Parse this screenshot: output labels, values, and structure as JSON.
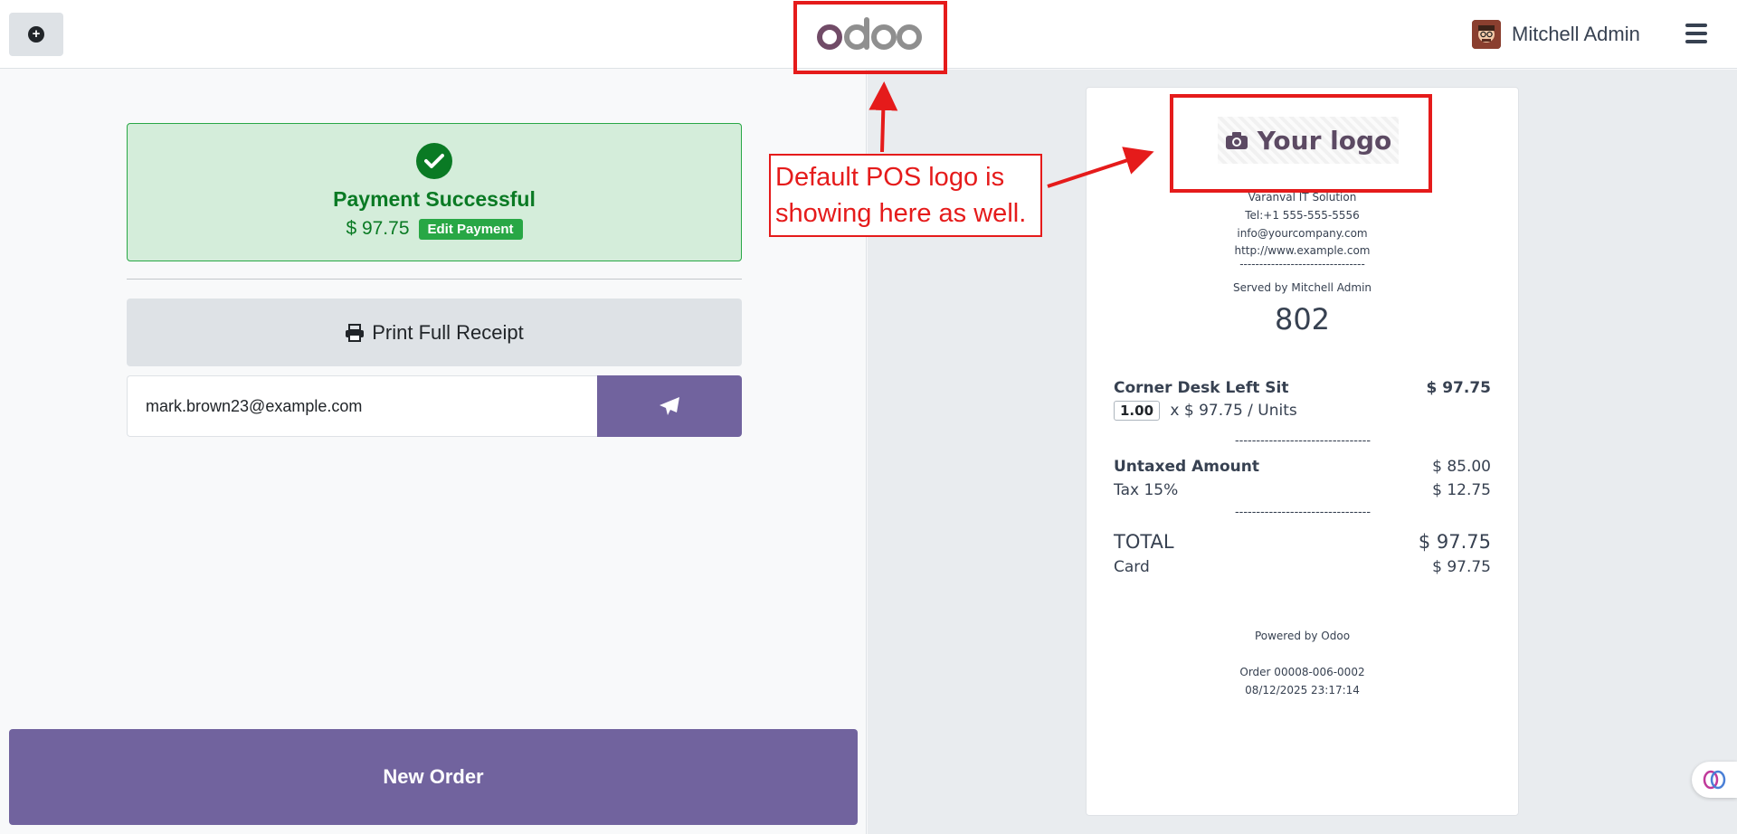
{
  "topbar": {
    "add_button": "plus-circle-icon",
    "brand": "odoo",
    "user_name": "Mitchell Admin"
  },
  "payment": {
    "status": "Payment Successful",
    "amount": "$ 97.75",
    "edit_label": "Edit Payment",
    "print_label": "Print Full Receipt",
    "email_value": "mark.brown23@example.com",
    "new_order_label": "New Order"
  },
  "receipt": {
    "logo_text": "Your logo",
    "company": "Varanval IT Solution",
    "phone": "Tel:+1 555-555-5556",
    "email": "info@yourcompany.com",
    "website": "http://www.example.com",
    "separator": "--------------------------------",
    "served_by": "Served by Mitchell Admin",
    "order_number": "802",
    "line": {
      "product": "Corner Desk Left Sit",
      "price": "$ 97.75",
      "qty": "1.00",
      "unit_detail": "x $ 97.75 / Units"
    },
    "dash_line": "--------------------------------",
    "untaxed_label": "Untaxed Amount",
    "untaxed_value": "$ 85.00",
    "tax_label": "Tax 15%",
    "tax_value": "$ 12.75",
    "total_label": "TOTAL",
    "total_value": "$ 97.75",
    "card_label": "Card",
    "card_value": "$ 97.75",
    "powered_by": "Powered by Odoo",
    "order_ref": "Order 00008-006-0002",
    "datetime": "08/12/2025 23:17:14"
  },
  "annotation": {
    "text": "Default POS logo is showing here as well.",
    "color": "#e51b1b"
  },
  "colors": {
    "accent": "#71639e",
    "success_bg": "#d4edda",
    "success_text": "#0a7a24"
  }
}
